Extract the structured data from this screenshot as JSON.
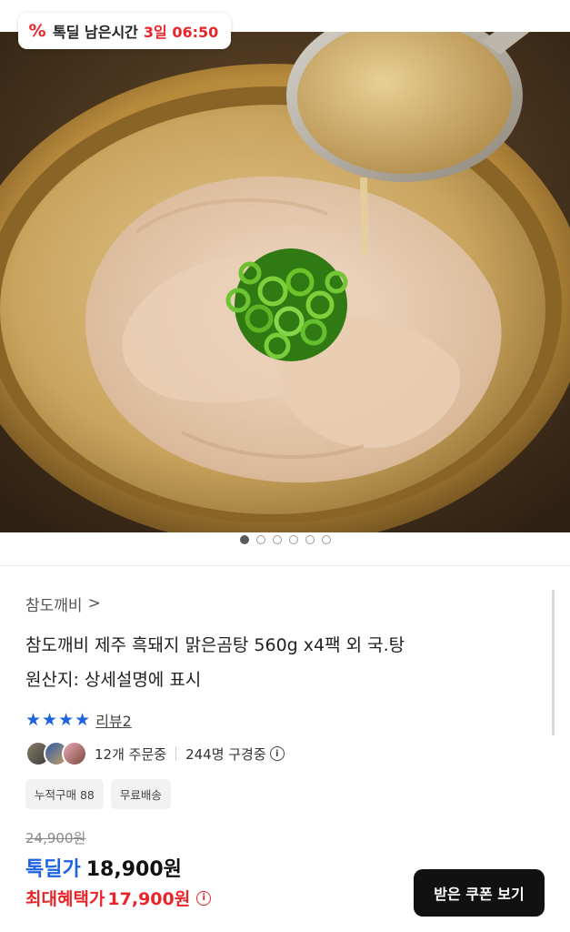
{
  "timer": {
    "icon": "percent-icon",
    "glyph": "%",
    "label": "톡딜 남은시간",
    "time": "3일 06:50"
  },
  "gallery": {
    "image_count": 6,
    "active_index": 0,
    "image_alt": "product-photo-gomtang"
  },
  "product": {
    "brand": "참도깨비",
    "brand_chevron": ">",
    "title_line1": "참도깨비 제주 흑돼지 맑은곰탕 560g x4팩 외 국.탕",
    "title_line2": "원산지: 상세설명에 표시",
    "rating_stars": 4,
    "review_label": "리뷰2"
  },
  "stats": {
    "orders": "12개 주문중",
    "browsing": "244명 구경중",
    "info_glyph": "i"
  },
  "chips": [
    "누적구매 88",
    "무료배송"
  ],
  "price": {
    "original": "24,900원",
    "deal_label": "톡딜가",
    "deal_price": "18,900원",
    "max_label": "최대혜택가",
    "max_price": "17,900원"
  },
  "coupon_button": "받은 쿠폰 보기",
  "colors": {
    "accent_blue": "#1f63e0",
    "accent_red": "#e8262a",
    "button_black": "#111111"
  }
}
